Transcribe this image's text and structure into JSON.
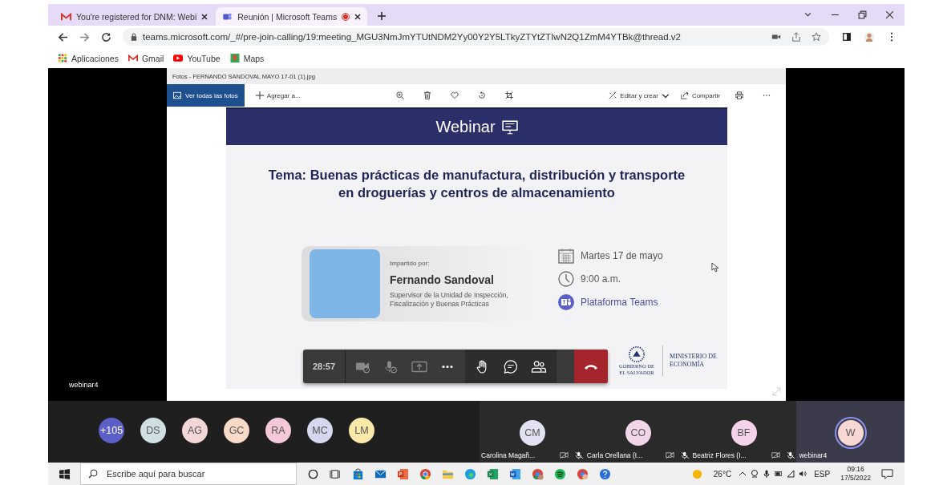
{
  "browser": {
    "tabs": [
      {
        "title": "You're registered for DNM: Webi",
        "selected": false,
        "recording": false
      },
      {
        "title": "Reunión | Microsoft Teams",
        "selected": true,
        "recording": true
      }
    ],
    "url": "teams.microsoft.com/_#/pre-join-calling/19:meeting_MGU3NmJmYTUtNDM2Yy00Y2Y5LTkyZTYtZTIwN2Q1ZmM4YTBk@thread.v2",
    "bookmarks": [
      {
        "label": "Aplicaciones",
        "kind": "apps"
      },
      {
        "label": "Gmail",
        "kind": "gmail"
      },
      {
        "label": "YouTube",
        "kind": "youtube"
      },
      {
        "label": "Maps",
        "kind": "maps"
      }
    ]
  },
  "photos": {
    "title": "Fotos - FERNANDO SANDOVAL MAYO 17-01 (1).jpg",
    "view_all": "Ver todas las fotos",
    "add": "Agregar a...",
    "edit": "Editar y crear",
    "share": "Compartir"
  },
  "slide": {
    "header": "Webinar",
    "topic": "Tema: Buenas prácticas de manufactura, distribución y transporte en droguerías y centros de almacenamiento",
    "speaker_label": "Impartido por:",
    "speaker_name": "Fernando Sandoval",
    "speaker_role": "Supervisor de la Unidad de Inspección, Fiscalización y Buenas Prácticas",
    "date": "Martes 17 de mayo",
    "time": "9:00 a.m.",
    "platform": "Plataforma Teams",
    "logo_caption": "GOBIERNO DE EL SALVADOR",
    "logo_text": "MINISTERIO DE ECONOMÍA"
  },
  "call": {
    "timer": "28:57",
    "presenter": "webinar4"
  },
  "attendees": [
    {
      "initials": "+105",
      "color": "#5b5fc7"
    },
    {
      "initials": "DS",
      "color": "#cfdfe2"
    },
    {
      "initials": "AG",
      "color": "#f3d6d6"
    },
    {
      "initials": "GC",
      "color": "#f9d9c8"
    },
    {
      "initials": "RA",
      "color": "#f4c8d8"
    },
    {
      "initials": "MC",
      "color": "#d7d8f0"
    },
    {
      "initials": "LM",
      "color": "#fbe9a9"
    }
  ],
  "tiles": [
    {
      "initials": "CM",
      "name": "Carolina Magañ...",
      "color": "#e2e1f2"
    },
    {
      "initials": "CO",
      "name": "Carla Orellana (I...",
      "color": "#f1d6ea"
    },
    {
      "initials": "BF",
      "name": "Beatriz Flores (I...",
      "color": "#f3d2ea"
    }
  ],
  "self": {
    "initials": "W",
    "name": "webinar4",
    "color": "#f8d8d2"
  },
  "taskbar": {
    "search_placeholder": "Escribe aquí para buscar",
    "weather": "26°C",
    "language": "ESP",
    "time": "09:16",
    "date": "17/5/2022"
  }
}
